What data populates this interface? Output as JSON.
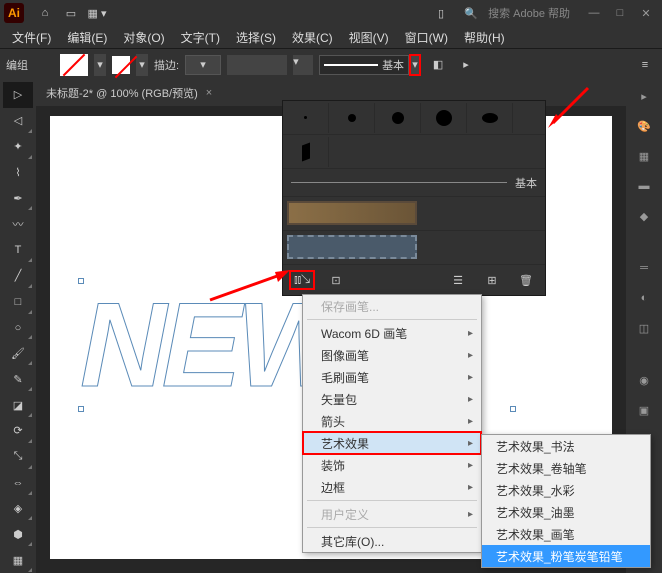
{
  "titlebar": {
    "search_placeholder": "搜索 Adobe 帮助"
  },
  "menubar": {
    "items": [
      "文件(F)",
      "编辑(E)",
      "对象(O)",
      "文字(T)",
      "选择(S)",
      "效果(C)",
      "视图(V)",
      "窗口(W)",
      "帮助(H)"
    ]
  },
  "optbar": {
    "mode": "编组",
    "stroke_label": "描边:",
    "stroke_style": "基本"
  },
  "doc": {
    "tab": "未标题-2* @ 100% (RGB/预览)",
    "text": "NEW"
  },
  "brush_panel": {
    "basic": "基本"
  },
  "ctx_menu": {
    "items": [
      {
        "label": "保存画笔...",
        "disabled": true,
        "sub": false
      },
      {
        "sep": true
      },
      {
        "label": "Wacom 6D 画笔",
        "sub": true
      },
      {
        "label": "图像画笔",
        "sub": true
      },
      {
        "label": "毛刷画笔",
        "sub": true
      },
      {
        "label": "矢量包",
        "sub": true
      },
      {
        "label": "箭头",
        "sub": true
      },
      {
        "label": "艺术效果",
        "sub": true,
        "hl": true,
        "redbox": true
      },
      {
        "label": "装饰",
        "sub": true
      },
      {
        "label": "边框",
        "sub": true
      },
      {
        "sep": true
      },
      {
        "label": "用户定义",
        "disabled": true,
        "sub": true
      },
      {
        "sep": true
      },
      {
        "label": "其它库(O)...",
        "sub": false
      }
    ]
  },
  "sub_menu": {
    "items": [
      {
        "label": "艺术效果_书法"
      },
      {
        "label": "艺术效果_卷轴笔"
      },
      {
        "label": "艺术效果_水彩"
      },
      {
        "label": "艺术效果_油墨"
      },
      {
        "label": "艺术效果_画笔"
      },
      {
        "label": "艺术效果_粉笔炭笔铅笔",
        "sel": true
      }
    ]
  }
}
